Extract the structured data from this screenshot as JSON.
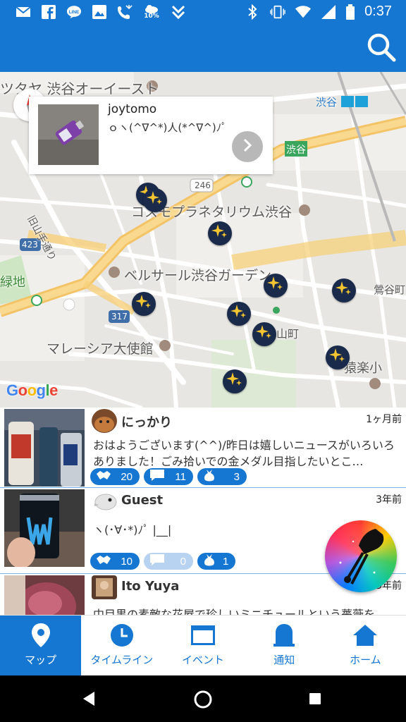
{
  "status_bar": {
    "time": "0:37",
    "notification_icons": [
      "mail-icon",
      "facebook-icon",
      "line-icon",
      "image-icon",
      "missed-call-icon",
      "weather-icon",
      "app-icon"
    ],
    "weather_percent": "10%",
    "system_icons": [
      "bluetooth-icon",
      "vibrate-icon",
      "wifi-icon",
      "signal-icon",
      "battery-icon"
    ]
  },
  "app_bar": {
    "search_icon": "search-icon"
  },
  "map": {
    "labels": [
      "ツタヤ 渋谷オーイースト",
      "渋谷",
      "渋谷",
      "246",
      "コスモプラネタリウム渋谷",
      "旧山手通り",
      "423",
      "ベルサール渋谷ガーデン",
      "鶯谷町",
      "緑地",
      "317",
      "山町",
      "マレーシア大使館",
      "猿楽小"
    ],
    "google_logo": "Google",
    "pin_icon": "sparkle-pin-icon"
  },
  "popup": {
    "username": "joytomo",
    "message": "ｏヽ(^∇^*)人(*^∇^)ﾉﾟ",
    "go_icon": "chevron-right-icon"
  },
  "posts": [
    {
      "username": "にっかり",
      "time": "1ヶ月前",
      "text": "おはようございます(^^)/昨日は嬉しいニュースがいろいろありました！ごみ拾いでの金メダル目指したいとこ…",
      "likes": "20",
      "comments": "11",
      "bags": "3"
    },
    {
      "username": "Guest",
      "time": "3年前",
      "text": "ヽ(･∀･*)ﾉﾟ |__|",
      "likes": "10",
      "comments": "0",
      "bags": "1"
    },
    {
      "username": "Ito Yuya",
      "time": "3年前",
      "text": "中目黒の素敵な花屋で珍しいミニチュールという薔薇を…"
    }
  ],
  "bottom_nav": [
    {
      "label": "マップ",
      "icon": "map-pin-icon"
    },
    {
      "label": "タイムライン",
      "icon": "clock-icon"
    },
    {
      "label": "イベント",
      "icon": "event-card-icon"
    },
    {
      "label": "通知",
      "icon": "bell-icon"
    },
    {
      "label": "ホーム",
      "icon": "home-icon"
    }
  ],
  "colors": {
    "primary": "#1677d2",
    "badge_faded": "#b8d3f1",
    "pin": "#1a2a4a",
    "pin_star": "#f4c531"
  }
}
